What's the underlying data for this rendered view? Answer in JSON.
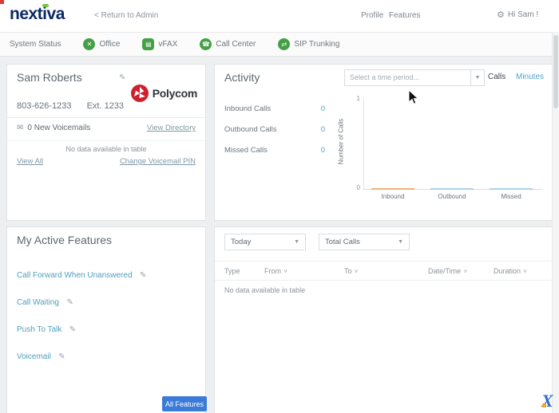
{
  "header": {
    "logo": "nextiva",
    "return_link": "< Return to Admin",
    "nav": [
      {
        "label": "Profile"
      },
      {
        "label": "Features"
      }
    ],
    "greeting": "Hi Sam !"
  },
  "status_bar": {
    "title": "System Status",
    "services": [
      {
        "label": "Office"
      },
      {
        "label": "vFAX"
      },
      {
        "label": "Call Center"
      },
      {
        "label": "SIP Trunking"
      }
    ]
  },
  "profile_card": {
    "name": "Sam Roberts",
    "brand": "Polycom",
    "phone": "803-626-1233",
    "ext": "Ext. 1233",
    "voicemails": "0 New Voicemails",
    "view_directory": "View Directory",
    "empty_text": "No data available in table",
    "view_all": "View All",
    "change_pin": "Change Voicemail PIN"
  },
  "activity_card": {
    "title": "Activity",
    "period_placeholder": "Select a time period...",
    "calls_label": "Calls",
    "minutes_label": "Minutes",
    "stats": [
      {
        "label": "Inbound Calls",
        "value": "0"
      },
      {
        "label": "Outbound Calls",
        "value": "0"
      },
      {
        "label": "Missed Calls",
        "value": "0"
      }
    ]
  },
  "chart_data": {
    "type": "bar",
    "categories": [
      "Inbound",
      "Outbound",
      "Missed"
    ],
    "values": [
      0,
      0,
      0
    ],
    "title": "",
    "xlabel": "",
    "ylabel": "Number of Calls",
    "ylim": [
      0,
      1
    ],
    "yticks": [
      "1",
      "0"
    ],
    "grid": false,
    "legend": false
  },
  "features_card": {
    "title": "My Active Features",
    "items": [
      {
        "label": "Call Forward When Unanswered"
      },
      {
        "label": "Call Waiting"
      },
      {
        "label": "Push To Talk"
      },
      {
        "label": "Voicemail"
      }
    ],
    "all_features_label": "All Features"
  },
  "calls_panel": {
    "period_filter": "Today",
    "type_filter": "Total Calls",
    "columns": [
      {
        "label": "Type"
      },
      {
        "label": "From"
      },
      {
        "label": "To"
      },
      {
        "label": "Date/Time"
      },
      {
        "label": "Duration"
      }
    ],
    "empty_text": "No data available in table"
  },
  "colors": {
    "logo_navy": "#0b2a63",
    "accent_green": "#43a047",
    "link_blue": "#4fa0c0",
    "stat_value_blue": "#4a9bc4",
    "button_blue": "#3b7bd8",
    "polycom_red": "#cf1f2f",
    "bar_inbound": "#f0b27a",
    "bar_other": "#a9d3ea"
  }
}
